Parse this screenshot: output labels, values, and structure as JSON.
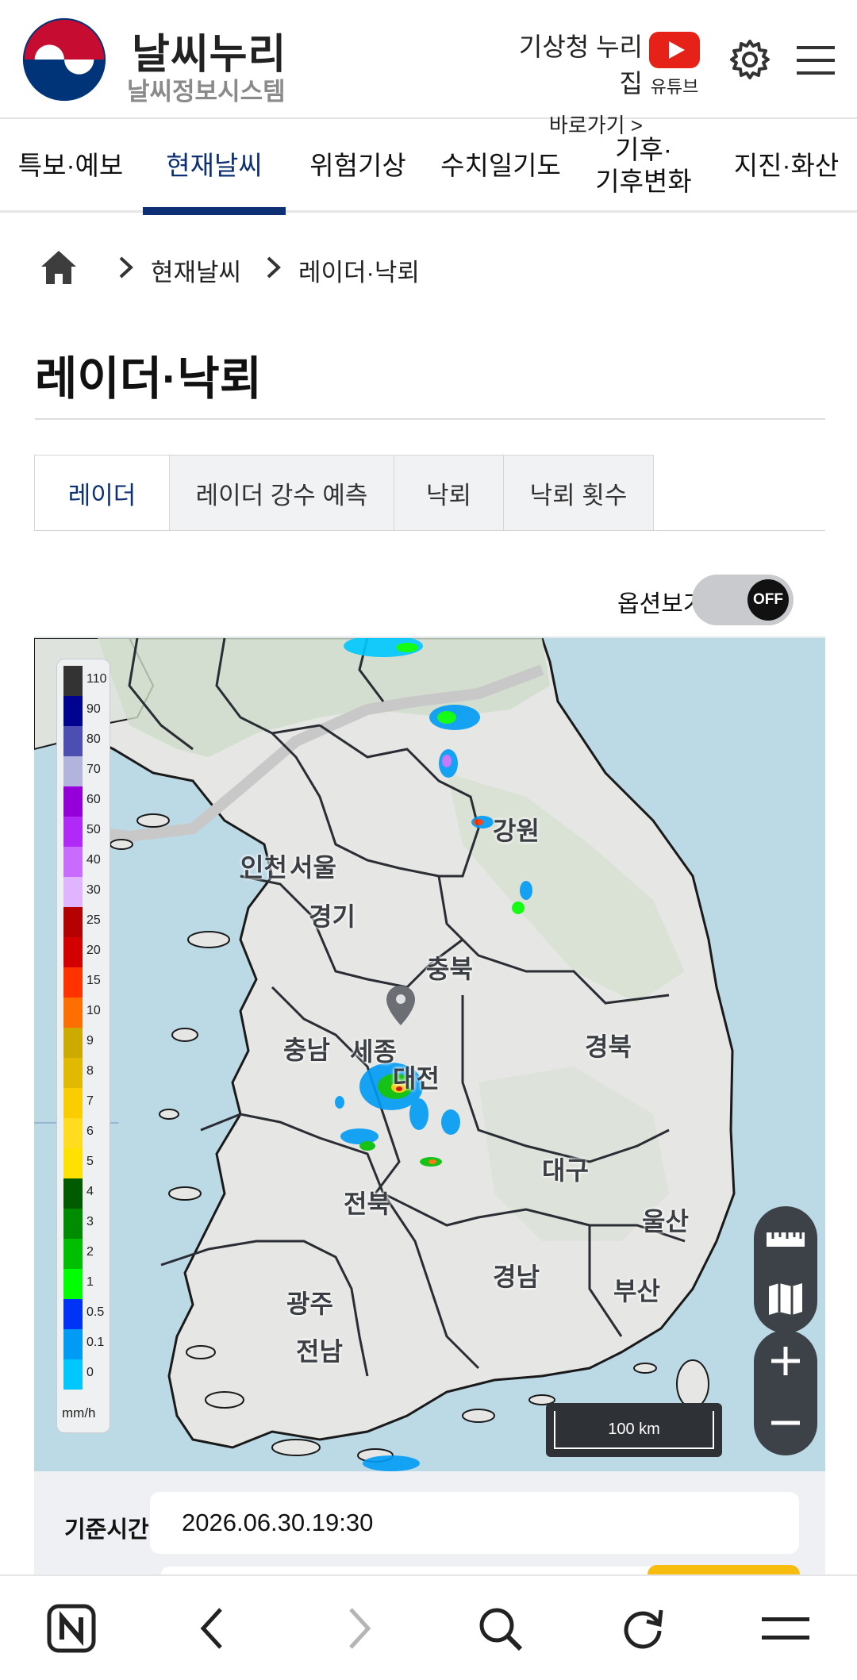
{
  "header": {
    "brand_title": "날씨누리",
    "brand_subtitle": "날씨정보시스템",
    "nuri_title": "기상청 누리집",
    "nuri_goto": "바로가기 >",
    "youtube_label": "유튜브"
  },
  "gnb": {
    "items": [
      {
        "label": "특보·예보"
      },
      {
        "label": "현재날씨"
      },
      {
        "label": "위험기상"
      },
      {
        "label": "수치일기도"
      },
      {
        "label": "기후·\n기후변화"
      },
      {
        "label": "지진·화산"
      }
    ],
    "active_index": 1
  },
  "breadcrumb": {
    "items": [
      "현재날씨",
      "레이더·낙뢰"
    ]
  },
  "page_title": "레이더·낙뢰",
  "tabs": {
    "items": [
      "레이더",
      "레이더 강수 예측",
      "낙뢰",
      "낙뢰 횟수"
    ],
    "active_index": 0
  },
  "option": {
    "label": "옵션보기",
    "toggle_state": "OFF"
  },
  "map": {
    "regions": [
      "인천",
      "서울",
      "경기",
      "강원",
      "충북",
      "충남",
      "세종",
      "대전",
      "경북",
      "대구",
      "전북",
      "울산",
      "경남",
      "부산",
      "광주",
      "전남"
    ],
    "legend": {
      "unit": "mm/h",
      "steps": [
        {
          "value": "110",
          "color": "#333333"
        },
        {
          "value": "90",
          "color": "#000390"
        },
        {
          "value": "80",
          "color": "#4c4eb1"
        },
        {
          "value": "70",
          "color": "#b3b4de"
        },
        {
          "value": "60",
          "color": "#9500d9"
        },
        {
          "value": "50",
          "color": "#b029f7"
        },
        {
          "value": "40",
          "color": "#c96bff"
        },
        {
          "value": "30",
          "color": "#e0b4ff"
        },
        {
          "value": "25",
          "color": "#b40000"
        },
        {
          "value": "20",
          "color": "#d20000"
        },
        {
          "value": "15",
          "color": "#ff3200"
        },
        {
          "value": "10",
          "color": "#ff6e00"
        },
        {
          "value": "9",
          "color": "#ccaa00"
        },
        {
          "value": "8",
          "color": "#e0b900"
        },
        {
          "value": "7",
          "color": "#f9cd00"
        },
        {
          "value": "6",
          "color": "#ffdc1f"
        },
        {
          "value": "5",
          "color": "#ffe100"
        },
        {
          "value": "4",
          "color": "#005a00"
        },
        {
          "value": "3",
          "color": "#008c00"
        },
        {
          "value": "2",
          "color": "#00be00"
        },
        {
          "value": "1",
          "color": "#00ff00"
        },
        {
          "value": "0.5",
          "color": "#0033f5"
        },
        {
          "value": "0.1",
          "color": "#009bf5"
        },
        {
          "value": "0",
          "color": "#00c8ff"
        }
      ]
    },
    "scale_label": "100 km"
  },
  "info": {
    "base_time_label": "기준시간",
    "base_time_value": "2026.06.30.19:30"
  },
  "colors": {
    "brand_navy": "#0d2f74",
    "youtube_red": "#e62117",
    "accent_yellow": "#f6bd0e"
  }
}
